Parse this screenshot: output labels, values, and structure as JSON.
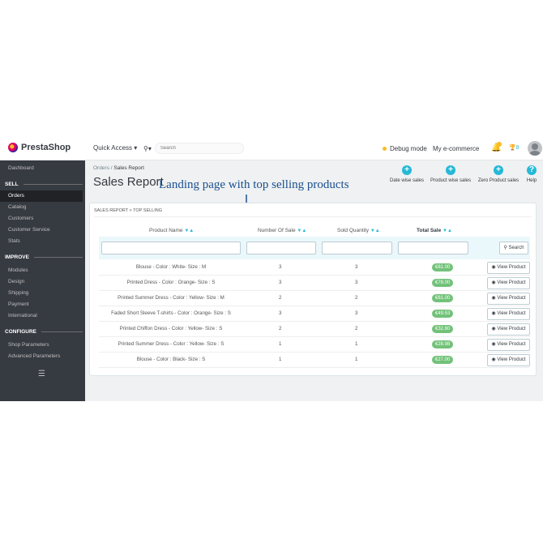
{
  "topbar": {
    "logo_brand": "Presta",
    "logo_brand2": "Shop",
    "quick_access": "Quick Access ▾",
    "search_placeholder": "Search",
    "debug_mode": "Debug mode",
    "shop_name": "My e-commerce",
    "trophy_count": "8"
  },
  "sidebar": {
    "dashboard": "Dashboard",
    "section_sell": "SELL",
    "sell_items": [
      "Orders",
      "Catalog",
      "Customers",
      "Customer Service",
      "Stats"
    ],
    "section_improve": "IMPROVE",
    "improve_items": [
      "Modules",
      "Design",
      "Shipping",
      "Payment",
      "International"
    ],
    "section_configure": "CONFIGURE",
    "configure_items": [
      "Shop Parameters",
      "Advanced Parameters"
    ],
    "active": "Orders"
  },
  "header": {
    "breadcrumb_root": "Orders",
    "breadcrumb_sep": "/",
    "breadcrumb_current": "Sales Report",
    "title": "Sales Report",
    "toolbar": [
      {
        "label": "Date wise sales",
        "icon": "plus-circle-icon"
      },
      {
        "label": "Product wise sales",
        "icon": "plus-circle-icon"
      },
      {
        "label": "Zero Product sales",
        "icon": "plus-circle-icon"
      },
      {
        "label": "Help",
        "icon": "help-icon"
      }
    ]
  },
  "annotation": "Landing page with top selling products",
  "panel": {
    "heading": "SALES REPORT > TOP SELLING",
    "columns": [
      "Product Name",
      "Number Of Sale",
      "Sold Quantity",
      "Total Sale"
    ],
    "sort_glyph": "▼▲",
    "search_label": "Search",
    "view_label": "View Product",
    "rows": [
      {
        "name": "Blouse - Color : White- Size : M",
        "sales": "3",
        "qty": "3",
        "total": "€81.00"
      },
      {
        "name": "Printed Dress - Color : Orange- Size : S",
        "sales": "3",
        "qty": "3",
        "total": "€78.00"
      },
      {
        "name": "Printed Summer Dress - Color : Yellow- Size : M",
        "sales": "2",
        "qty": "2",
        "total": "€61.00"
      },
      {
        "name": "Faded Short Sleeve T-shirts - Color : Orange- Size : S",
        "sales": "3",
        "qty": "3",
        "total": "€49.53"
      },
      {
        "name": "Printed Chiffon Dress - Color : Yellow- Size : S",
        "sales": "2",
        "qty": "2",
        "total": "€32.80"
      },
      {
        "name": "Printed Summer Dress - Color : Yellow- Size : S",
        "sales": "1",
        "qty": "1",
        "total": "€28.98"
      },
      {
        "name": "Blouse - Color : Black- Size : S",
        "sales": "1",
        "qty": "1",
        "total": "€27.00"
      }
    ]
  },
  "colors": {
    "accent": "#25b9d7",
    "sidebar_bg": "#363a41",
    "price_badge": "#72c279",
    "annotation": "#1a4f8f"
  }
}
